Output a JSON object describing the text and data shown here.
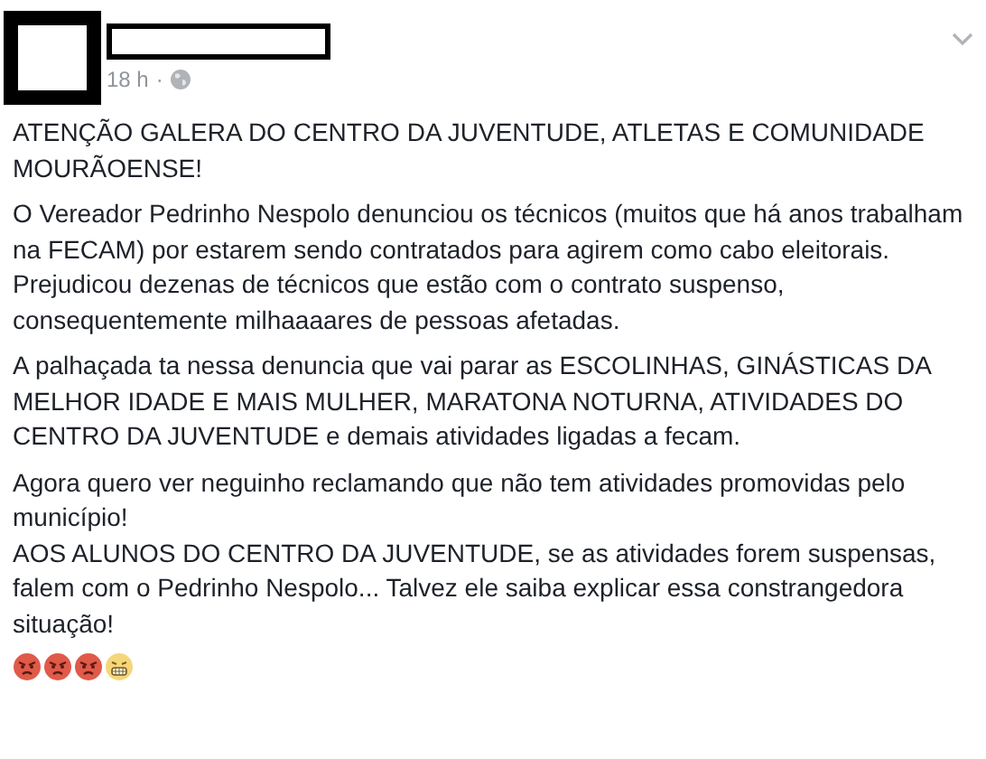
{
  "post": {
    "time": "18 h",
    "separator": "·",
    "paragraphs": [
      [
        "ATENÇÃO GALERA DO CENTRO DA JUVENTUDE, ATLETAS E COMUNIDADE MOURÃOENSE!"
      ],
      [
        "O Vereador Pedrinho Nespolo denunciou os técnicos (muitos que há anos trabalham na FECAM) por estarem sendo contratados para agirem como cabo eleitorais. Prejudicou dezenas de técnicos que estão com o contrato suspenso, consequentemente milhaaaares de pessoas afetadas."
      ],
      [
        "A palhaçada ta nessa denuncia que vai parar as ESCOLINHAS, GINÁSTICAS DA MELHOR IDADE E MAIS MULHER, MARATONA NOTURNA, ATIVIDADES DO CENTRO DA JUVENTUDE e demais atividades ligadas a fecam."
      ],
      [
        "Agora quero ver neguinho reclamando que não tem atividades promovidas pelo município!",
        "AOS ALUNOS DO CENTRO DA JUVENTUDE, se as atividades forem suspensas, falem com o Pedrinho Nespolo... Talvez ele saiba explicar essa constrangedora situação!"
      ]
    ],
    "emojis": [
      {
        "kind": "angry"
      },
      {
        "kind": "angry"
      },
      {
        "kind": "angry"
      },
      {
        "kind": "grimace"
      }
    ]
  }
}
